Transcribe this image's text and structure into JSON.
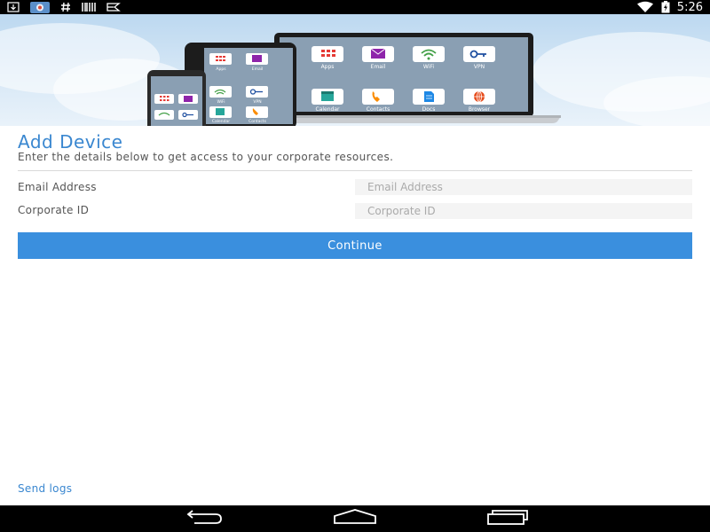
{
  "status_bar": {
    "left_icons": [
      "download-icon",
      "app-thumbnail-icon",
      "hash-icon",
      "barcode-icon",
      "tray-icon"
    ],
    "right_icons": [
      "wifi-icon",
      "battery-charging-icon"
    ],
    "time": "5:26"
  },
  "hero": {
    "app_tiles": [
      {
        "label": "Apps",
        "icon": "apps-grid-icon",
        "color": "#e53935"
      },
      {
        "label": "Email",
        "icon": "envelope-icon",
        "color": "#8e24aa"
      },
      {
        "label": "WiFi",
        "icon": "wifi-icon",
        "color": "#43a047"
      },
      {
        "label": "VPN",
        "icon": "key-icon",
        "color": "#1e4fa0"
      },
      {
        "label": "Calendar",
        "icon": "calendar-icon",
        "color": "#26a69a"
      },
      {
        "label": "Contacts",
        "icon": "phone-icon",
        "color": "#fb8c00"
      },
      {
        "label": "Docs",
        "icon": "document-icon",
        "color": "#1e88e5"
      },
      {
        "label": "Browser",
        "icon": "globe-icon",
        "color": "#e64a19"
      }
    ]
  },
  "form": {
    "title": "Add Device",
    "subtitle": "Enter the details below to get access to your corporate resources.",
    "email_label": "Email Address",
    "email_placeholder": "Email Address",
    "email_value": "",
    "corporate_label": "Corporate ID",
    "corporate_placeholder": "Corporate ID",
    "corporate_value": "",
    "continue_label": "Continue"
  },
  "footer": {
    "send_logs_label": "Send logs"
  },
  "nav_bar": {
    "buttons": [
      "back-icon",
      "home-icon",
      "recents-icon"
    ]
  },
  "colors": {
    "accent": "#3a87d0",
    "button": "#3a8fde",
    "status_bar": "#000000"
  }
}
